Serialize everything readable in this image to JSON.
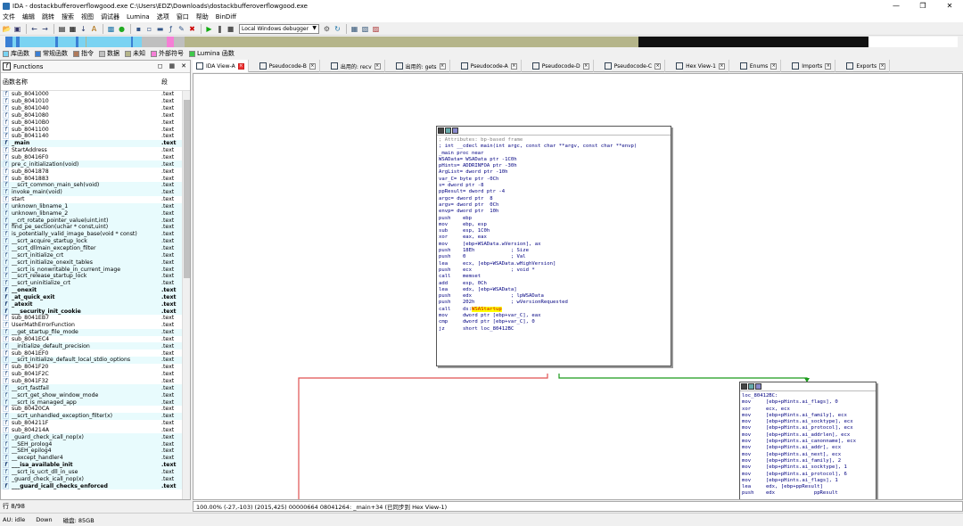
{
  "window": {
    "title": "IDA - dostackbufferoverflowgood.exe C:\\Users\\EDZ\\Downloads\\dostackbufferoverflowgood.exe"
  },
  "menu": [
    "文件",
    "编辑",
    "跳转",
    "搜索",
    "视图",
    "调试器",
    "Lumina",
    "选项",
    "窗口",
    "帮助",
    "BinDiff"
  ],
  "toolbar": {
    "debugger_label": "Local Windows debugger"
  },
  "legend": [
    {
      "label": "库函数",
      "color": "#7ad3f2"
    },
    {
      "label": "常规函数",
      "color": "#3a7fd4"
    },
    {
      "label": "指令",
      "color": "#b07a5a"
    },
    {
      "label": "数据",
      "color": "#bfbfbf"
    },
    {
      "label": "未知",
      "color": "#b5b58a"
    },
    {
      "label": "外部符号",
      "color": "#f57fd6"
    },
    {
      "label": "Lumina 函数",
      "color": "#3ec94a"
    }
  ],
  "functions_panel": {
    "title": "Functions",
    "col_name": "函数名称",
    "col_seg": "段",
    "rows": [
      {
        "name": "sub_8041000",
        "seg": ".text",
        "hl": false,
        "bold": false
      },
      {
        "name": "sub_8041010",
        "seg": ".text",
        "hl": false,
        "bold": false
      },
      {
        "name": "sub_8041040",
        "seg": ".text",
        "hl": false,
        "bold": false
      },
      {
        "name": "sub_8041080",
        "seg": ".text",
        "hl": false,
        "bold": false
      },
      {
        "name": "sub_80410B0",
        "seg": ".text",
        "hl": false,
        "bold": false
      },
      {
        "name": "sub_8041100",
        "seg": ".text",
        "hl": false,
        "bold": false
      },
      {
        "name": "sub_8041140",
        "seg": ".text",
        "hl": false,
        "bold": false
      },
      {
        "name": "_main",
        "seg": ".text",
        "hl": true,
        "bold": true
      },
      {
        "name": "StartAddress",
        "seg": ".text",
        "hl": false,
        "bold": false
      },
      {
        "name": "sub_80416F0",
        "seg": ".text",
        "hl": false,
        "bold": false
      },
      {
        "name": "pre_c_initialization(void)",
        "seg": ".text",
        "hl": true,
        "bold": false
      },
      {
        "name": "sub_8041878",
        "seg": ".text",
        "hl": false,
        "bold": false
      },
      {
        "name": "sub_8041883",
        "seg": ".text",
        "hl": false,
        "bold": false
      },
      {
        "name": "__scrt_common_main_seh(void)",
        "seg": ".text",
        "hl": true,
        "bold": false
      },
      {
        "name": "invoke_main(void)",
        "seg": ".text",
        "hl": true,
        "bold": false
      },
      {
        "name": "start",
        "seg": ".text",
        "hl": false,
        "bold": false
      },
      {
        "name": "unknown_libname_1",
        "seg": ".text",
        "hl": true,
        "bold": false
      },
      {
        "name": "unknown_libname_2",
        "seg": ".text",
        "hl": true,
        "bold": false
      },
      {
        "name": "__crt_rotate_pointer_value(uint,int)",
        "seg": ".text",
        "hl": true,
        "bold": false
      },
      {
        "name": "find_pe_section(uchar * const,uint)",
        "seg": ".text",
        "hl": true,
        "bold": false
      },
      {
        "name": "is_potentially_valid_image_base(void * const)",
        "seg": ".text",
        "hl": true,
        "bold": false
      },
      {
        "name": "__scrt_acquire_startup_lock",
        "seg": ".text",
        "hl": true,
        "bold": false
      },
      {
        "name": "__scrt_dllmain_exception_filter",
        "seg": ".text",
        "hl": true,
        "bold": false
      },
      {
        "name": "__scrt_initialize_crt",
        "seg": ".text",
        "hl": true,
        "bold": false
      },
      {
        "name": "__scrt_initialize_onexit_tables",
        "seg": ".text",
        "hl": true,
        "bold": false
      },
      {
        "name": "__scrt_is_nonwritable_in_current_image",
        "seg": ".text",
        "hl": true,
        "bold": false
      },
      {
        "name": "__scrt_release_startup_lock",
        "seg": ".text",
        "hl": true,
        "bold": false
      },
      {
        "name": "__scrt_uninitialize_crt",
        "seg": ".text",
        "hl": true,
        "bold": false
      },
      {
        "name": "__onexit",
        "seg": ".text",
        "hl": true,
        "bold": true
      },
      {
        "name": "_at_quick_exit",
        "seg": ".text",
        "hl": true,
        "bold": true
      },
      {
        "name": "_atexit",
        "seg": ".text",
        "hl": true,
        "bold": true
      },
      {
        "name": "___security_init_cookie",
        "seg": ".text",
        "hl": true,
        "bold": true
      },
      {
        "name": "sub_8041EB7",
        "seg": ".text",
        "hl": false,
        "bold": false
      },
      {
        "name": "UserMathErrorFunction",
        "seg": ".text",
        "hl": false,
        "bold": false
      },
      {
        "name": "__get_startup_file_mode",
        "seg": ".text",
        "hl": true,
        "bold": false
      },
      {
        "name": "sub_8041EC4",
        "seg": ".text",
        "hl": false,
        "bold": false
      },
      {
        "name": "__initialize_default_precision",
        "seg": ".text",
        "hl": true,
        "bold": false
      },
      {
        "name": "sub_8041EF0",
        "seg": ".text",
        "hl": false,
        "bold": false
      },
      {
        "name": "__scrt_initialize_default_local_stdio_options",
        "seg": ".text",
        "hl": true,
        "bold": false
      },
      {
        "name": "sub_8041F20",
        "seg": ".text",
        "hl": false,
        "bold": false
      },
      {
        "name": "sub_8041F2C",
        "seg": ".text",
        "hl": false,
        "bold": false
      },
      {
        "name": "sub_8041F32",
        "seg": ".text",
        "hl": false,
        "bold": false
      },
      {
        "name": "__scrt_fastfail",
        "seg": ".text",
        "hl": true,
        "bold": false
      },
      {
        "name": "__scrt_get_show_window_mode",
        "seg": ".text",
        "hl": true,
        "bold": false
      },
      {
        "name": "__scrt_is_managed_app",
        "seg": ".text",
        "hl": true,
        "bold": false
      },
      {
        "name": "sub_80420CA",
        "seg": ".text",
        "hl": false,
        "bold": false
      },
      {
        "name": "__scrt_unhandled_exception_filter(x)",
        "seg": ".text",
        "hl": true,
        "bold": false
      },
      {
        "name": "sub_804211F",
        "seg": ".text",
        "hl": false,
        "bold": false
      },
      {
        "name": "sub_804214A",
        "seg": ".text",
        "hl": false,
        "bold": false
      },
      {
        "name": "_guard_check_icall_nop(x)",
        "seg": ".text",
        "hl": true,
        "bold": false
      },
      {
        "name": "__SEH_prolog4",
        "seg": ".text",
        "hl": true,
        "bold": false
      },
      {
        "name": "__SEH_epilog4",
        "seg": ".text",
        "hl": true,
        "bold": false
      },
      {
        "name": "__except_handler4",
        "seg": ".text",
        "hl": true,
        "bold": false
      },
      {
        "name": "___isa_available_init",
        "seg": ".text",
        "hl": true,
        "bold": true
      },
      {
        "name": "__scrt_is_ucrt_dll_in_use",
        "seg": ".text",
        "hl": true,
        "bold": false
      },
      {
        "name": "_guard_check_icall_nop(x)",
        "seg": ".text",
        "hl": true,
        "bold": false
      },
      {
        "name": "___guard_icall_checks_enforced",
        "seg": ".text",
        "hl": true,
        "bold": true
      }
    ]
  },
  "row_count": "行 8/98",
  "tabs": [
    {
      "label": "IDA View-A",
      "active": true
    },
    {
      "label": "Pseudocode-B",
      "active": false
    },
    {
      "label": "出用的: recv",
      "active": false
    },
    {
      "label": "出用的: gets",
      "active": false
    },
    {
      "label": "Pseudocode-A",
      "active": false
    },
    {
      "label": "Pseudocode-D",
      "active": false
    },
    {
      "label": "Pseudocode-C",
      "active": false
    },
    {
      "label": "Hex View-1",
      "active": false
    },
    {
      "label": "Enums",
      "active": false
    },
    {
      "label": "Imports",
      "active": false
    },
    {
      "label": "Exports",
      "active": false
    }
  ],
  "node_main": {
    "lines": [
      {
        "t": "",
        "c": "cmt"
      },
      {
        "t": "; Attributes: bp-based frame",
        "c": "cmt"
      },
      {
        "t": "",
        "c": "cmt"
      },
      {
        "t": "; int __cdecl main(int argc, const char **argv, const char **envp)",
        "c": "name"
      },
      {
        "t": "_main proc near",
        "c": "name"
      },
      {
        "t": "",
        "c": "name"
      },
      {
        "t": "WSAData= WSAData ptr -1C0h",
        "c": "name"
      },
      {
        "t": "pHints= ADDRINFOA ptr -30h",
        "c": "name"
      },
      {
        "t": "ArgList= dword ptr -10h",
        "c": "name"
      },
      {
        "t": "var_C= byte ptr -0Ch",
        "c": "name"
      },
      {
        "t": "s= dword ptr -8",
        "c": "name"
      },
      {
        "t": "ppResult= dword ptr -4",
        "c": "name"
      },
      {
        "t": "argc= dword ptr  8",
        "c": "name"
      },
      {
        "t": "argv= dword ptr  0Ch",
        "c": "name"
      },
      {
        "t": "envp= dword ptr  10h",
        "c": "name"
      },
      {
        "t": "",
        "c": "name"
      },
      {
        "t": "push    ebp",
        "c": "name"
      },
      {
        "t": "mov     ebp, esp",
        "c": "name"
      },
      {
        "t": "sub     esp, 1C0h",
        "c": "name"
      },
      {
        "t": "xor     eax, eax",
        "c": "name"
      },
      {
        "t": "mov     [ebp+WSAData.wVersion], ax",
        "c": "name"
      },
      {
        "t": "push    18Eh            ; Size",
        "c": "name"
      },
      {
        "t": "push    0               ; Val",
        "c": "name"
      },
      {
        "t": "lea     ecx, [ebp+WSAData.wHighVersion]",
        "c": "name"
      },
      {
        "t": "push    ecx             ; void *",
        "c": "name"
      },
      {
        "t": "call    memset",
        "c": "name"
      },
      {
        "t": "add     esp, 0Ch",
        "c": "name"
      },
      {
        "t": "lea     edx, [ebp+WSAData]",
        "c": "name"
      },
      {
        "t": "push    edx             ; lpWSAData",
        "c": "name"
      },
      {
        "t": "push    202h            ; wVersionRequested",
        "c": "name"
      },
      {
        "t": "call    ds:WSAStartup",
        "c": "name",
        "hl": "WSAStartup"
      },
      {
        "t": "mov     dword ptr [ebp+var_C], eax",
        "c": "name"
      },
      {
        "t": "cmp     dword ptr [ebp+var_C], 0",
        "c": "name"
      },
      {
        "t": "jz      short loc_80412BC",
        "c": "name"
      }
    ]
  },
  "node_loc": {
    "lines": [
      {
        "t": "loc_80412BC:",
        "c": "name"
      },
      {
        "t": "mov     [ebp+pHints.ai_flags], 0",
        "c": "name"
      },
      {
        "t": "xor     ecx, ecx",
        "c": "name"
      },
      {
        "t": "mov     [ebp+pHints.ai_family], ecx",
        "c": "name"
      },
      {
        "t": "mov     [ebp+pHints.ai_socktype], ecx",
        "c": "name"
      },
      {
        "t": "mov     [ebp+pHints.ai_protocol], ecx",
        "c": "name"
      },
      {
        "t": "mov     [ebp+pHints.ai_addrlen], ecx",
        "c": "name"
      },
      {
        "t": "mov     [ebp+pHints.ai_canonname], ecx",
        "c": "name"
      },
      {
        "t": "mov     [ebp+pHints.ai_addr], ecx",
        "c": "name"
      },
      {
        "t": "mov     [ebp+pHints.ai_next], ecx",
        "c": "name"
      },
      {
        "t": "mov     [ebp+pHints.ai_family], 2",
        "c": "name"
      },
      {
        "t": "mov     [ebp+pHints.ai_socktype], 1",
        "c": "name"
      },
      {
        "t": "mov     [ebp+pHints.ai_protocol], 6",
        "c": "name"
      },
      {
        "t": "mov     [ebp+pHints.ai_flags], 1",
        "c": "name"
      },
      {
        "t": "lea     edx, [ebp+ppResult]",
        "c": "name"
      },
      {
        "t": "push    edx             ppResult",
        "c": "name"
      }
    ]
  },
  "graph_status": "100.00% (-27,-103) (2015,425) 00000664 08041264: _main+34 (已同步到 Hex View-1)",
  "bottom": {
    "au": "AU:  idle",
    "dir": "Down",
    "disk": "磁盘: 85GB"
  }
}
